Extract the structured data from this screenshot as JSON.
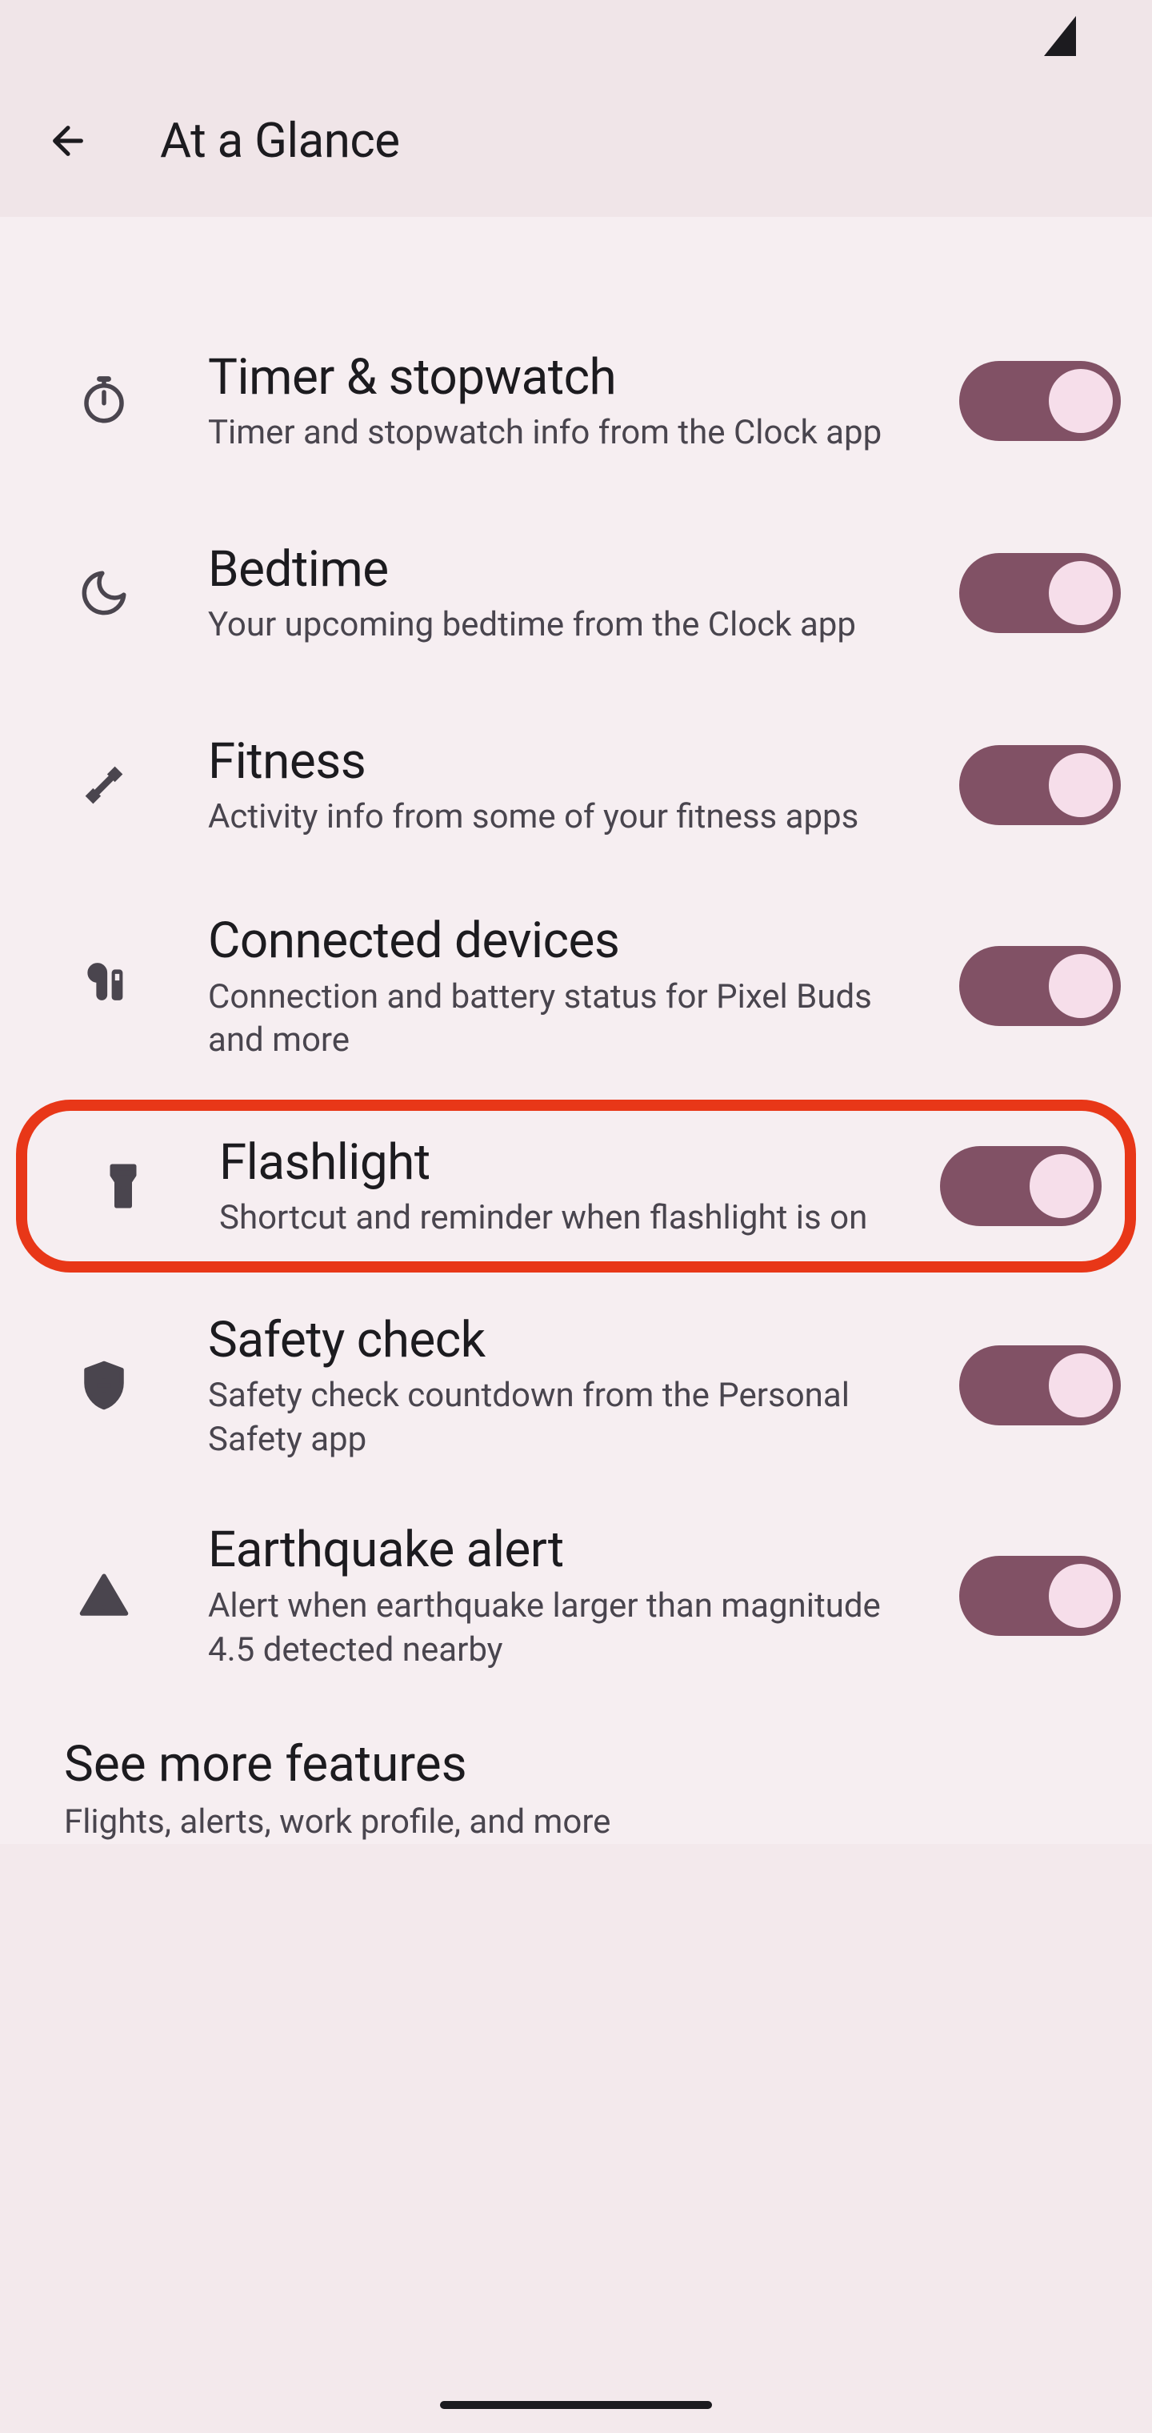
{
  "header": {
    "title": "At a Glance"
  },
  "settings": [
    {
      "icon": "stopwatch",
      "title": "Timer & stopwatch",
      "subtitle": "Timer and stopwatch info from the Clock app",
      "enabled": true
    },
    {
      "icon": "moon",
      "title": "Bedtime",
      "subtitle": "Your upcoming bedtime from the Clock app",
      "enabled": true
    },
    {
      "icon": "dumbbell",
      "title": "Fitness",
      "subtitle": "Activity info from some of your fitness apps",
      "enabled": true
    },
    {
      "icon": "earbuds",
      "title": "Connected devices",
      "subtitle": "Connection and battery status for Pixel Buds and more",
      "enabled": true
    },
    {
      "icon": "flashlight",
      "title": "Flashlight",
      "subtitle": "Shortcut and reminder when flashlight is on",
      "enabled": true,
      "highlighted": true
    },
    {
      "icon": "shield",
      "title": "Safety check",
      "subtitle": "Safety check countdown from the Personal Safety app",
      "enabled": true
    },
    {
      "icon": "warning",
      "title": "Earthquake alert",
      "subtitle": "Alert when earthquake larger than magnitude 4.5 detected nearby",
      "enabled": true
    }
  ],
  "footer": {
    "title": "See more features",
    "subtitle": "Flights, alerts, work profile, and more"
  }
}
